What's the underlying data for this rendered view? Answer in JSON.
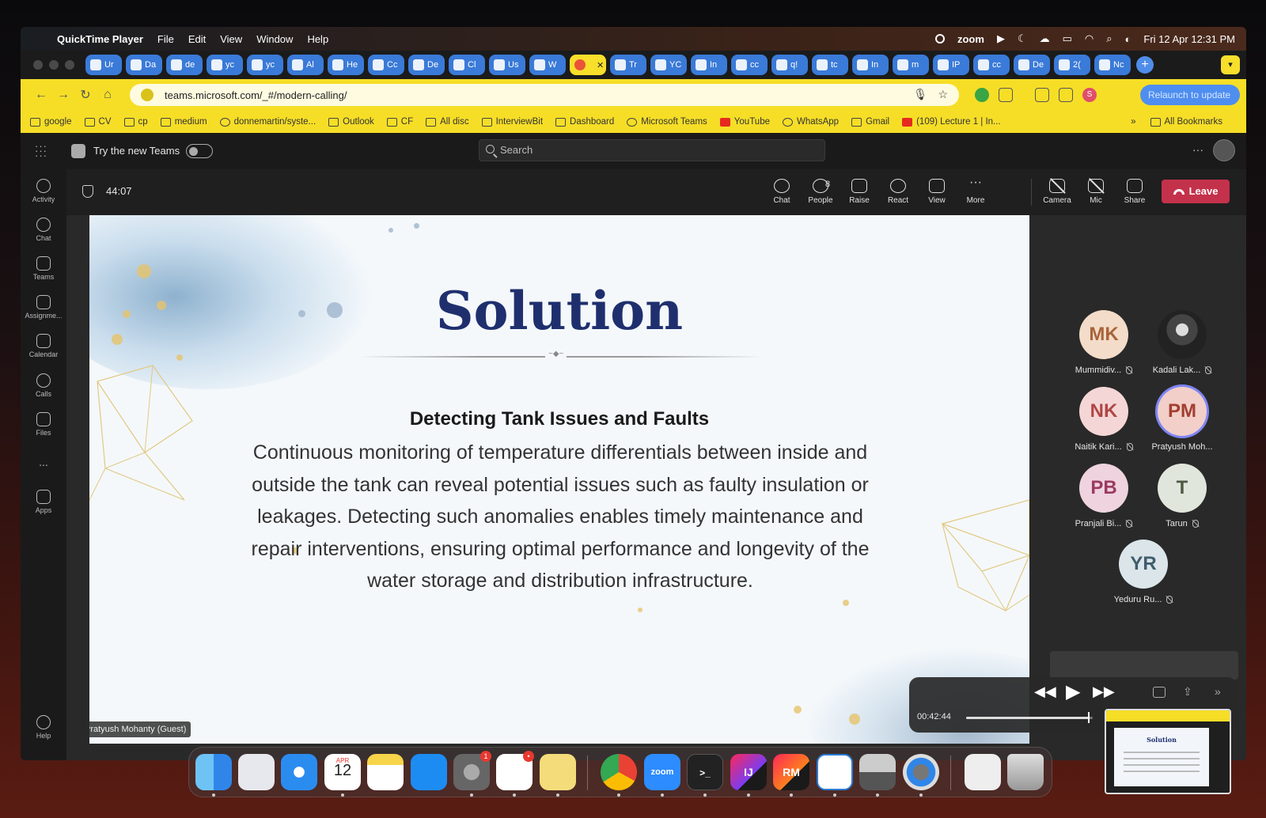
{
  "menubar": {
    "app_name": "QuickTime Player",
    "menus": [
      "File",
      "Edit",
      "View",
      "Window",
      "Help"
    ],
    "zoom_label": "zoom",
    "datetime": "Fri 12 Apr  12:31 PM"
  },
  "browser": {
    "tabs": [
      "Ur",
      "Da",
      "de",
      "yc",
      "yc",
      "Al",
      "He",
      "Cc",
      "De",
      "Cl",
      "Us",
      "W",
      "",
      "Tr",
      "YC",
      "In",
      "cc",
      "q!",
      "tc",
      "In",
      "m",
      "IP",
      "cc",
      "De",
      "2(",
      "Nc"
    ],
    "active_tab_index": 12,
    "url": "teams.microsoft.com/_#/modern-calling/",
    "relaunch_label": "Relaunch to update",
    "profile_initial": "S",
    "bookmarks": [
      "google",
      "CV",
      "cp",
      "medium",
      "donnemartin/syste...",
      "Outlook",
      "CF",
      "All disc",
      "InterviewBit",
      "Dashboard",
      "Microsoft Teams",
      "YouTube",
      "WhatsApp",
      "Gmail",
      "(109) Lecture 1 | In..."
    ],
    "bookmarks_overflow": "»",
    "all_bookmarks": "All Bookmarks"
  },
  "teams": {
    "try_new_label": "Try the new Teams",
    "search_placeholder": "Search",
    "rail": [
      {
        "label": "Activity",
        "icon": "bell-icon"
      },
      {
        "label": "Chat",
        "icon": "chat-icon"
      },
      {
        "label": "Teams",
        "icon": "teams-icon"
      },
      {
        "label": "Assignme...",
        "icon": "backpack-icon"
      },
      {
        "label": "Calendar",
        "icon": "calendar-icon"
      },
      {
        "label": "Calls",
        "icon": "phone-icon"
      },
      {
        "label": "Files",
        "icon": "file-icon"
      },
      {
        "label": "...",
        "icon": "more-icon"
      },
      {
        "label": "Apps",
        "icon": "apps-icon"
      },
      {
        "label": "Help",
        "icon": "help-icon"
      }
    ],
    "meeting": {
      "timer": "44:07",
      "controls": {
        "chat": "Chat",
        "people": "People",
        "people_count": "8",
        "raise": "Raise",
        "react": "React",
        "view": "View",
        "more": "More",
        "camera": "Camera",
        "mic": "Mic",
        "share": "Share",
        "leave": "Leave"
      },
      "presenter": "Pratyush Mohanty (Guest)",
      "participants": [
        {
          "initials": "MK",
          "name": "Mummidiv...",
          "color": "#f3dcc9",
          "text_color": "#a8643a"
        },
        {
          "initials": "",
          "name": "Kadali Lak...",
          "color": "#333333",
          "text_color": "#ffffff"
        },
        {
          "initials": "NK",
          "name": "Naitik Kari...",
          "color": "#f5d6d6",
          "text_color": "#b04646"
        },
        {
          "initials": "PM",
          "name": "Pratyush Moh...",
          "color": "#f2cfc8",
          "text_color": "#a13f30"
        },
        {
          "initials": "PB",
          "name": "Pranjali Bi...",
          "color": "#efd3de",
          "text_color": "#9b3b61"
        },
        {
          "initials": "T",
          "name": "Tarun",
          "color": "#e1e6dc",
          "text_color": "#4f5a45"
        },
        {
          "initials": "YR",
          "name": "Yeduru Ru...",
          "color": "#dbe5ea",
          "text_color": "#3f5d6c"
        }
      ]
    }
  },
  "slide": {
    "title": "Solution",
    "subtitle": "Detecting Tank Issues and Faults",
    "body": "Continuous monitoring of temperature differentials between inside and outside the tank can reveal potential issues such as faulty insulation or leakages. Detecting such anomalies enables timely maintenance and repair interventions, ensuring optimal performance and longevity of the water storage and distribution infrastructure."
  },
  "quicktime": {
    "current_time": "00:42:44",
    "progress": 0.97
  },
  "dock": {
    "calendar_month": "APR",
    "calendar_day": "12",
    "settings_badge": "1",
    "slack_badge": "•",
    "zoom_label": "zoom",
    "intellij_label": "IJ",
    "rubymine_label": "RM",
    "terminal_label": ">_"
  },
  "thumbnail": {
    "title": "Solution"
  }
}
